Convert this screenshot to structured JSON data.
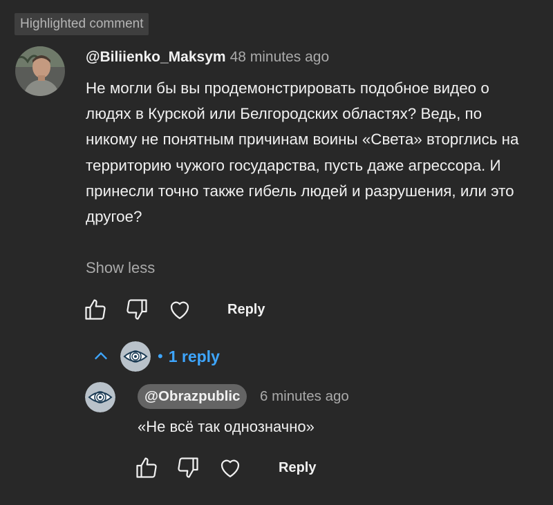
{
  "highlight_badge": "Highlighted comment",
  "comment": {
    "author": "@Biliienko_Maksym",
    "time": "48 minutes ago",
    "text": "Не могли бы вы продемонстрировать подобное видео о людях в Курской или Белгородских областях? Ведь, по никому не понятным причинам воины «Света» вторглись на территорию чужого государства, пусть даже агрессора. И принесли точно также гибель людей и разрушения, или это другое?",
    "show_less": "Show less",
    "reply_label": "Reply",
    "icons": [
      "thumb-up-icon",
      "thumb-down-icon",
      "heart-icon"
    ]
  },
  "replies": {
    "toggle_dot": "•",
    "toggle_label": "1 reply",
    "items": [
      {
        "author": "@Obrazpublic",
        "time": "6 minutes ago",
        "text": "«Не всё так однозначно»",
        "reply_label": "Reply"
      }
    ]
  },
  "colors": {
    "background": "#282828",
    "text": "#f1f1f1",
    "muted": "#aaaaaa",
    "accent_blue": "#3ea6ff",
    "badge_bg": "#3f3f3f",
    "chip_bg": "#646464"
  }
}
